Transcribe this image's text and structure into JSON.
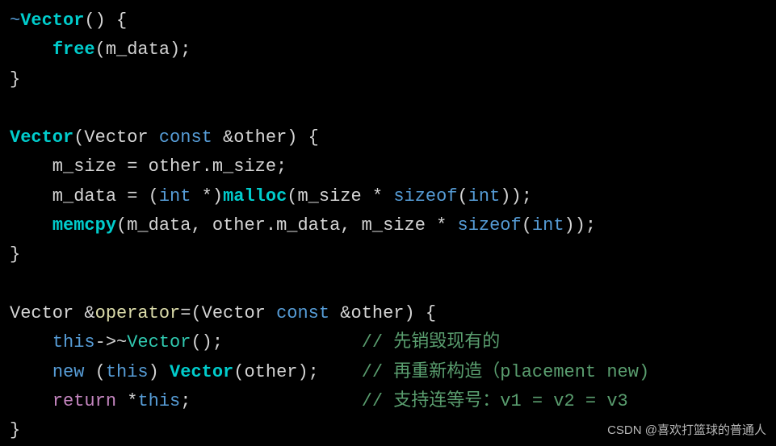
{
  "code": {
    "l1_tilde": "~",
    "l1_vector": "Vector",
    "l1_rest": "() {",
    "l2_free": "free",
    "l2_rest": "(m_data);",
    "l3": "}",
    "l5_vector": "Vector",
    "l5_p1": "(Vector ",
    "l5_const": "const",
    "l5_p2": " &other) {",
    "l6": "    m_size = other.m_size;",
    "l7_p1": "    m_data = (",
    "l7_int1": "int",
    "l7_p2": " *)",
    "l7_malloc": "malloc",
    "l7_p3": "(m_size * ",
    "l7_sizeof": "sizeof",
    "l7_p4": "(",
    "l7_int2": "int",
    "l7_p5": "));",
    "l8_memcpy": "memcpy",
    "l8_p1": "(m_data, other.m_data, m_size * ",
    "l8_sizeof": "sizeof",
    "l8_p2": "(",
    "l8_int": "int",
    "l8_p3": "));",
    "l9": "}",
    "l11_p1": "Vector &",
    "l11_op": "operator",
    "l11_p2": "=(Vector ",
    "l11_const": "const",
    "l11_p3": " &other) {",
    "l12_this": "this",
    "l12_p1": "->~",
    "l12_vector": "Vector",
    "l12_p2": "();",
    "l12_pad": "             ",
    "l12_comment": "// 先销毁现有的",
    "l13_new": "new",
    "l13_p1": " (",
    "l13_this": "this",
    "l13_p2": ") ",
    "l13_vector": "Vector",
    "l13_p3": "(other);",
    "l13_pad": "    ",
    "l13_comment": "// 再重新构造（placement new)",
    "l14_return": "return",
    "l14_p1": " *",
    "l14_this": "this",
    "l14_p2": ";",
    "l14_pad": "                ",
    "l14_comment": "// 支持连等号：v1 = v2 = v3",
    "l15": "}"
  },
  "watermark": "CSDN @喜欢打篮球的普通人"
}
